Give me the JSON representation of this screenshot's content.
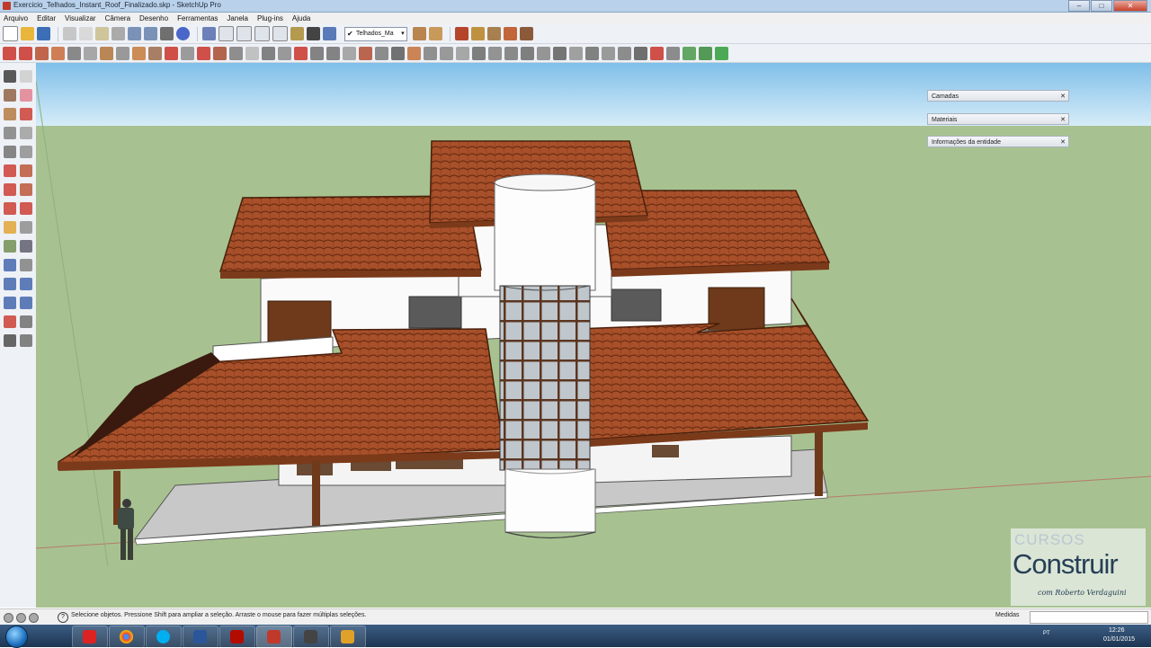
{
  "window": {
    "title": "Exercicio_Telhados_Instant_Roof_Finalizado.skp - SketchUp Pro",
    "buttons": {
      "minimize": "–",
      "maximize": "□",
      "close": "✕"
    }
  },
  "menubar": {
    "items": [
      "Arquivo",
      "Editar",
      "Visualizar",
      "Câmera",
      "Desenho",
      "Ferramentas",
      "Janela",
      "Plug-ins",
      "Ajuda"
    ]
  },
  "toolbar": {
    "scene_selector": {
      "checkmark": "✔",
      "value": "Telhados_Ma",
      "arrow": "▾"
    }
  },
  "panels": [
    {
      "label": "Camadas"
    },
    {
      "label": "Materiais"
    },
    {
      "label": "Informações da entidade"
    }
  ],
  "panel_close_glyph": "✕",
  "statusbar": {
    "help_glyph": "?",
    "text": "Selecione objetos. Pressione Shift para ampliar a seleção. Arraste o mouse para fazer múltiplas seleções.",
    "measurements_label": "Medidas",
    "measurements_value": ""
  },
  "taskbar": {
    "apps": [
      "chrome",
      "skype",
      "word",
      "acrobat",
      "sketchup",
      "media",
      "tools"
    ],
    "lang": "PT",
    "time": "12:26",
    "date": "01/01/2015"
  },
  "watermark": {
    "line1": "CURSOS",
    "line2": "Construir",
    "line3": "com Roberto Verdaguini"
  },
  "colors": {
    "sky": "#8cc4ea",
    "ground": "#a7c290",
    "roof": "#a8502a",
    "wall": "#ffffff",
    "wood": "#6e3a1b"
  }
}
